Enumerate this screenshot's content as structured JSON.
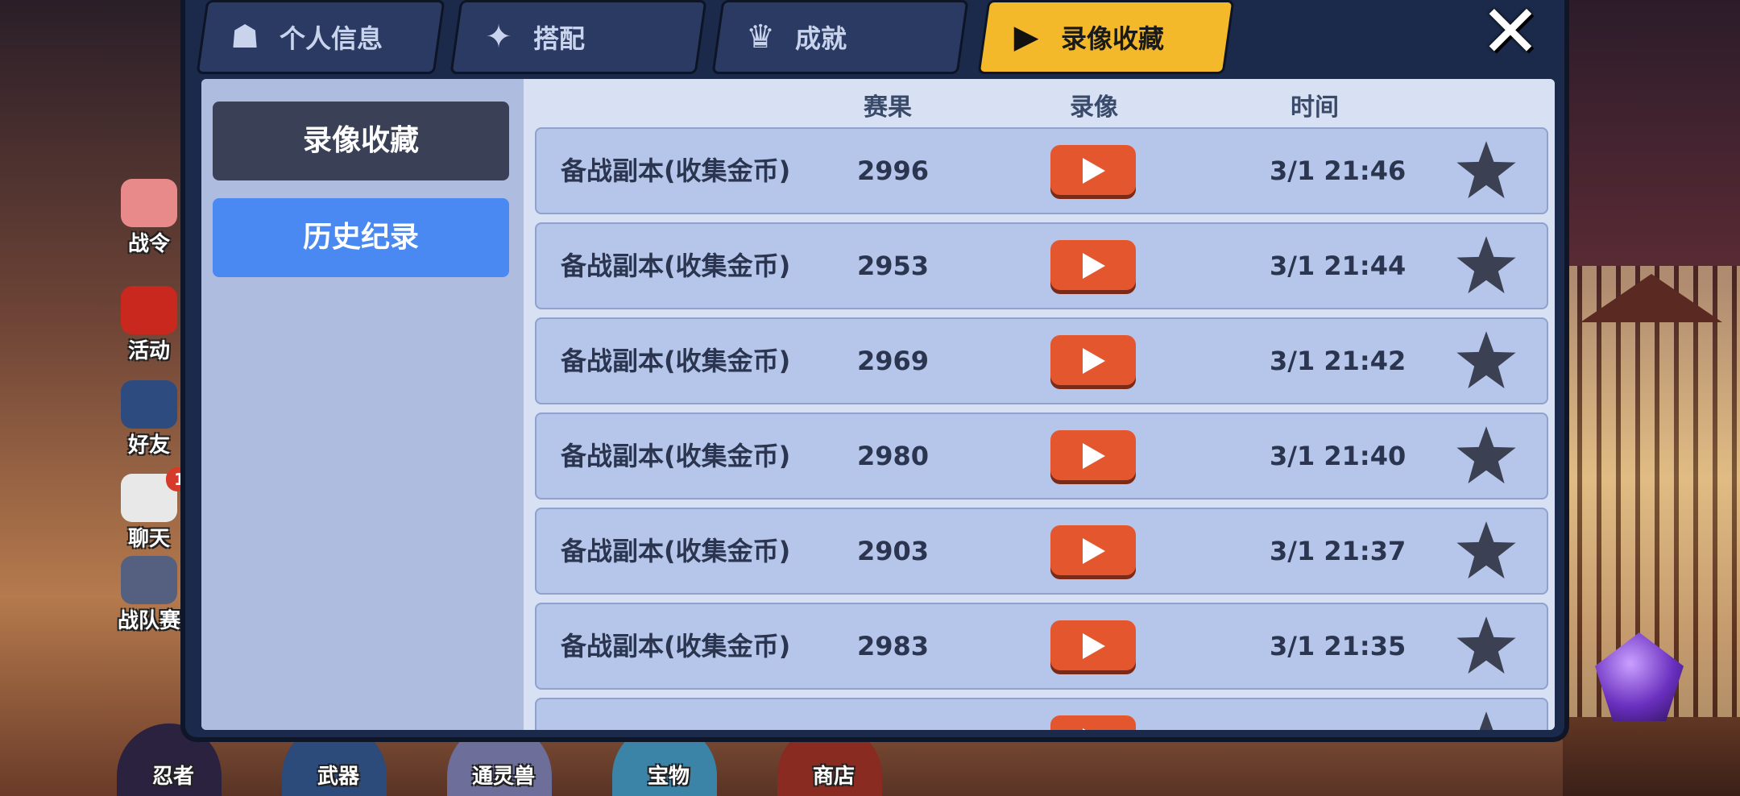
{
  "side_menu": [
    {
      "label": "战令",
      "icon": "rose-icon"
    },
    {
      "label": "活动",
      "icon": "torii-gate-icon"
    },
    {
      "label": "好友",
      "icon": "ninja-icon"
    },
    {
      "label": "聊天",
      "icon": "chat-bubble-icon",
      "badge": "1"
    },
    {
      "label": "战队赛",
      "icon": "crossed-swords-icon"
    }
  ],
  "bottom_nav": [
    {
      "label": "忍者"
    },
    {
      "label": "武器"
    },
    {
      "label": "通灵兽"
    },
    {
      "label": "宝物"
    },
    {
      "label": "商店"
    }
  ],
  "tabs": [
    {
      "label": "个人信息",
      "icon": "person-card-icon"
    },
    {
      "label": "搭配",
      "icon": "shuriken-icon"
    },
    {
      "label": "成就",
      "icon": "trophy-icon"
    },
    {
      "label": "录像收藏",
      "icon": "play-icon",
      "active": true
    }
  ],
  "left_buttons": {
    "favorites": "录像收藏",
    "history": "历史纪录"
  },
  "table": {
    "headers": {
      "result": "赛果",
      "replay": "录像",
      "time": "时间"
    },
    "rows": [
      {
        "name": "备战副本(收集金币)",
        "score": "2996",
        "time": "3/1 21:46"
      },
      {
        "name": "备战副本(收集金币)",
        "score": "2953",
        "time": "3/1 21:44"
      },
      {
        "name": "备战副本(收集金币)",
        "score": "2969",
        "time": "3/1 21:42"
      },
      {
        "name": "备战副本(收集金币)",
        "score": "2980",
        "time": "3/1 21:40"
      },
      {
        "name": "备战副本(收集金币)",
        "score": "2903",
        "time": "3/1 21:37"
      },
      {
        "name": "备战副本(收集金币)",
        "score": "2983",
        "time": "3/1 21:35"
      }
    ]
  },
  "close_symbol": "✕"
}
